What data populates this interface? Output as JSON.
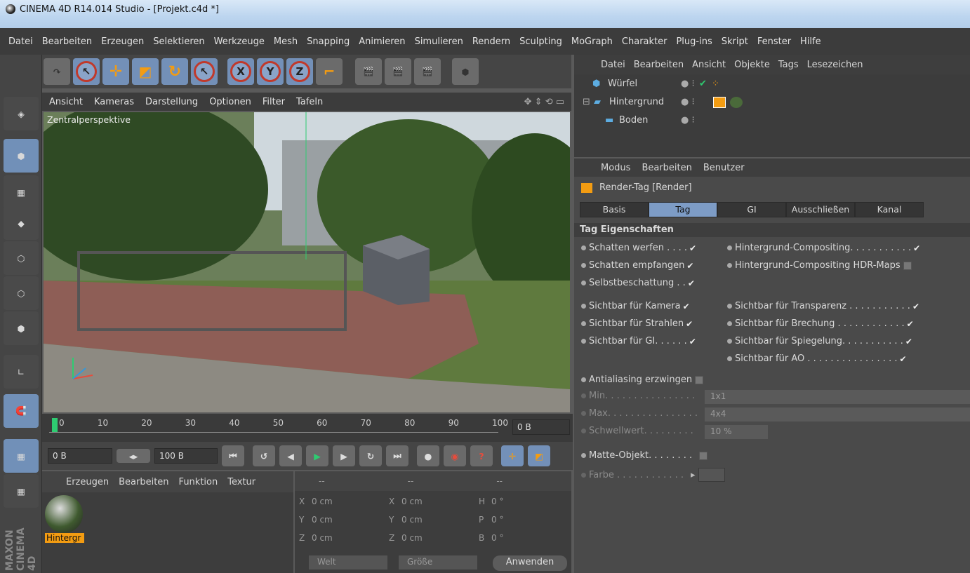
{
  "window": {
    "title": "CINEMA 4D R14.014 Studio - [Projekt.c4d *]"
  },
  "menu": [
    "Datei",
    "Bearbeiten",
    "Erzeugen",
    "Selektieren",
    "Werkzeuge",
    "Mesh",
    "Snapping",
    "Animieren",
    "Simulieren",
    "Rendern",
    "Sculpting",
    "MoGraph",
    "Charakter",
    "Plug-ins",
    "Skript",
    "Fenster",
    "Hilfe"
  ],
  "viewport": {
    "menu": [
      "Ansicht",
      "Kameras",
      "Darstellung",
      "Optionen",
      "Filter",
      "Tafeln"
    ],
    "label": "Zentralperspektive"
  },
  "timeline": {
    "ticks": [
      "0",
      "10",
      "20",
      "30",
      "40",
      "50",
      "60",
      "70",
      "80",
      "90",
      "100"
    ],
    "current": "0 B"
  },
  "transport": {
    "start": "0 B",
    "end": "100 B"
  },
  "materials": {
    "menu": [
      "Erzeugen",
      "Bearbeiten",
      "Funktion",
      "Textur"
    ],
    "item": "Hintergr"
  },
  "coords": {
    "header": [
      "--",
      "--",
      "--"
    ],
    "rows": [
      [
        "X",
        "0 cm",
        "X",
        "0 cm",
        "H",
        "0 °"
      ],
      [
        "Y",
        "0 cm",
        "Y",
        "0 cm",
        "P",
        "0 °"
      ],
      [
        "Z",
        "0 cm",
        "Z",
        "0 cm",
        "B",
        "0 °"
      ]
    ],
    "mode1": "Welt",
    "mode2": "Größe",
    "apply": "Anwenden"
  },
  "objects": {
    "menu": [
      "Datei",
      "Bearbeiten",
      "Ansicht",
      "Objekte",
      "Tags",
      "Lesezeichen"
    ],
    "items": [
      "Würfel",
      "Hintergrund",
      "Boden"
    ]
  },
  "attributes": {
    "menu": [
      "Modus",
      "Bearbeiten",
      "Benutzer"
    ],
    "title": "Render-Tag [Render]",
    "tabs": [
      "Basis",
      "Tag",
      "GI",
      "Ausschließen",
      "Kanal"
    ],
    "section": "Tag Eigenschaften",
    "left": [
      "Schatten werfen . . . .",
      "Schatten empfangen",
      "Selbstbeschattung . .",
      "Sichtbar für Kamera",
      "Sichtbar für Strahlen",
      "Sichtbar für GI. . . . . ."
    ],
    "right": [
      "Hintergrund-Compositing. . . . . . . . . . .",
      "Hintergrund-Compositing HDR-Maps",
      "Sichtbar für Transparenz . . . . . . . . . . .",
      "Sichtbar für Brechung . . . . . . . . . . . .",
      "Sichtbar für Spiegelung. . . . . . . . . . .",
      "Sichtbar für AO . . . . . . . . . . . . . . . ."
    ],
    "antialias": "Antialiasing erzwingen",
    "min_label": "Min. . . . . . . . . . . . . . . .",
    "min_val": "1x1",
    "max_label": "Max. . . . . . . . . . . . . . . .",
    "max_val": "4x4",
    "schwell_label": "Schwellwert. . . . . . . . .",
    "schwell_val": "10 %",
    "matte": "Matte-Objekt. . . . . . . .",
    "farbe": "Farbe . . . . . . . . . . . ."
  }
}
